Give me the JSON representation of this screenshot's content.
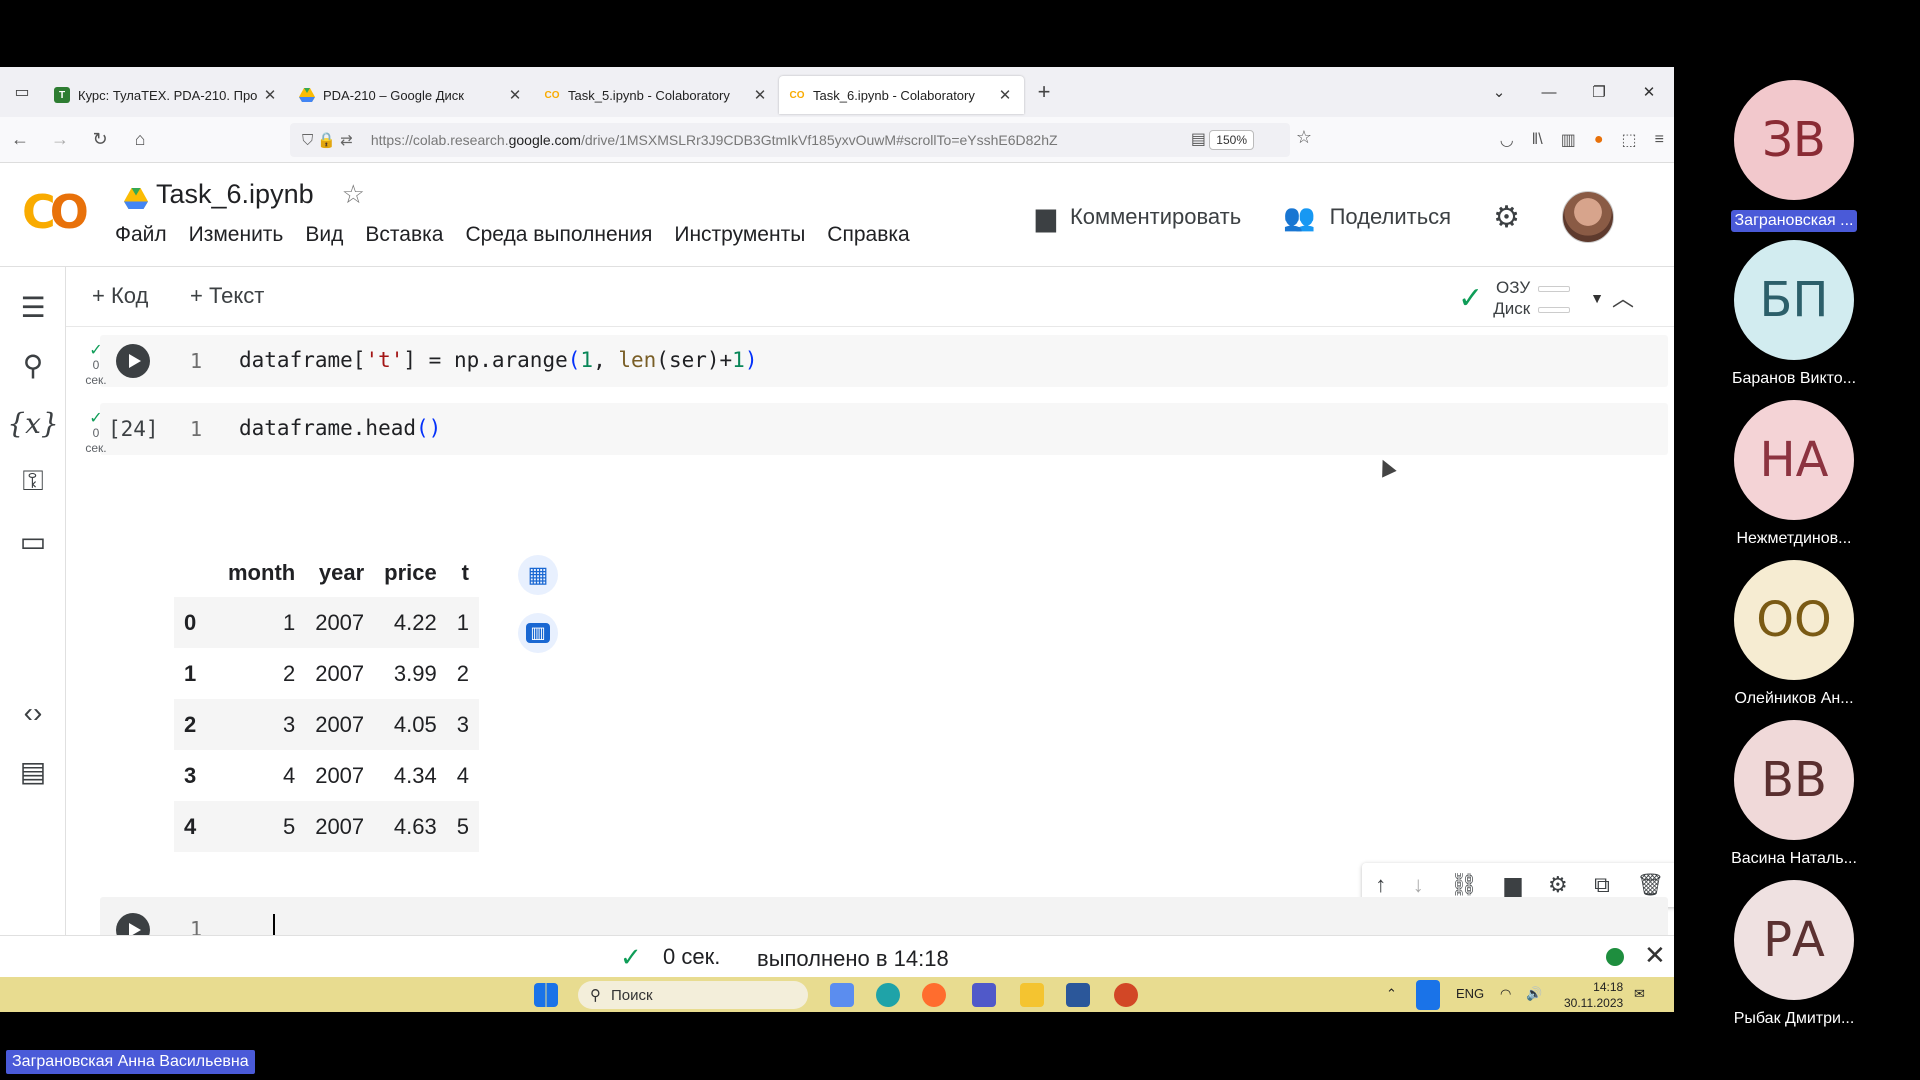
{
  "browser": {
    "tabs": [
      {
        "title": "Курс: ТулаТЕХ. PDA-210. Про",
        "icon": "moodle-icon",
        "active": false
      },
      {
        "title": "PDA-210 – Google Диск",
        "icon": "google-drive-icon",
        "active": false
      },
      {
        "title": "Task_5.ipynb - Colaboratory",
        "icon": "colab-icon",
        "active": false
      },
      {
        "title": "Task_6.ipynb - Colaboratory",
        "icon": "colab-icon",
        "active": true
      }
    ],
    "url_prefix": "https://colab.research.",
    "url_domain": "google.com",
    "url_rest": "/drive/1MSXMSLRr3J9CDB3GtmIkVf185yxvOuwM#scrollTo=eYsshE6D82hZ",
    "zoom": "150%"
  },
  "colab": {
    "notebook_title": "Task_6.ipynb",
    "menu": [
      "Файл",
      "Изменить",
      "Вид",
      "Вставка",
      "Среда выполнения",
      "Инструменты",
      "Справка"
    ],
    "comment_label": "Комментировать",
    "share_label": "Поделиться",
    "add_code": "+ Код",
    "add_text": "+ Текст",
    "ram_label": "ОЗУ",
    "disk_label": "Диск"
  },
  "cells": [
    {
      "exec_time": "0",
      "exec_unit": "сек.",
      "line": "1",
      "code_parts": [
        "dataframe[",
        "'t'",
        "] = np.arange",
        "(",
        "1",
        ", ",
        "len",
        "(ser)+",
        "1",
        ")"
      ]
    },
    {
      "exec_time": "0",
      "exec_unit": "сек.",
      "count": "[24]",
      "line": "1",
      "code_parts": [
        "dataframe.head",
        "()"
      ]
    },
    {
      "line": "1"
    }
  ],
  "output_table": {
    "columns": [
      "month",
      "year",
      "price",
      "t"
    ],
    "rows": [
      {
        "index": "0",
        "month": "1",
        "year": "2007",
        "price": "4.22",
        "t": "1"
      },
      {
        "index": "1",
        "month": "2",
        "year": "2007",
        "price": "3.99",
        "t": "2"
      },
      {
        "index": "2",
        "month": "3",
        "year": "2007",
        "price": "4.05",
        "t": "3"
      },
      {
        "index": "3",
        "month": "4",
        "year": "2007",
        "price": "4.34",
        "t": "4"
      },
      {
        "index": "4",
        "month": "5",
        "year": "2007",
        "price": "4.63",
        "t": "5"
      }
    ]
  },
  "status": {
    "duration": "0 сек.",
    "completed": "выполнено в 14:18"
  },
  "taskbar": {
    "search_placeholder": "Поиск",
    "lang": "ENG",
    "time": "14:18",
    "date": "30.11.2023"
  },
  "participants": [
    {
      "initials": "ЗВ",
      "name": "Заграновская ...",
      "bg": "#f2c8cc",
      "fg": "#8a2b34",
      "badge": true
    },
    {
      "initials": "БП",
      "name": "Баранов Викто...",
      "bg": "#d2ecf0",
      "fg": "#2c5f6a",
      "badge": false
    },
    {
      "initials": "НА",
      "name": "Нежметдинов...",
      "bg": "#f4d3d6",
      "fg": "#8c3340",
      "badge": false
    },
    {
      "initials": "ОО",
      "name": "Олейников Ан...",
      "bg": "#f6ecd2",
      "fg": "#7a5a14",
      "badge": false
    },
    {
      "initials": "ВВ",
      "name": "Васина Наталь...",
      "bg": "#f0d9d9",
      "fg": "#5a2f2f",
      "badge": false
    },
    {
      "initials": "РА",
      "name": "Рыбак Дмитри...",
      "bg": "#efe1e1",
      "fg": "#5b3131",
      "badge": false
    }
  ],
  "speaker_name": "Заграновская Анна Васильевна"
}
